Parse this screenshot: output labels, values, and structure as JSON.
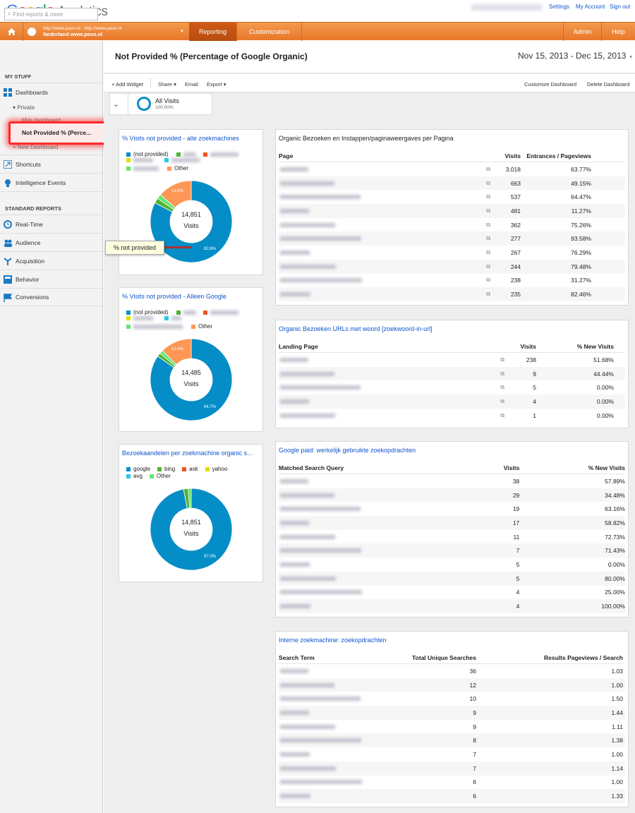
{
  "header": {
    "logo_google": "Google",
    "logo_app": "Analytics",
    "links": [
      "Settings",
      "My Account",
      "Sign out"
    ]
  },
  "nav": {
    "site_url": "http://www.pavo.nl - http://www.pavo.nl",
    "site_name": "Nederland www.pavo.nl",
    "tabs": [
      "Reporting",
      "Customization"
    ],
    "right": [
      "Admin",
      "Help"
    ]
  },
  "sidebar": {
    "search_placeholder": "Find reports & more",
    "my_stuff": "MY STUFF",
    "dashboards": "Dashboards",
    "private": "Private",
    "mijn": "Mijn dashboard",
    "not_provided": "Not Provided % (Perce...",
    "new_dashboard": "+ New Dashboard",
    "shortcuts": "Shortcuts",
    "intelligence": "Intelligence Events",
    "standard": "STANDARD REPORTS",
    "reports": [
      "Real-Time",
      "Audience",
      "Acquisition",
      "Behavior",
      "Conversions"
    ]
  },
  "page": {
    "title": "Not Provided % (Percentage of Google Organic)",
    "daterange": "Nov 15, 2013 - Dec 15, 2013"
  },
  "toolbar": {
    "add_widget": "+ Add Widget",
    "share": "Share",
    "email": "Email",
    "export": "Export",
    "customize": "Customize Dashboard",
    "delete": "Delete Dashboard"
  },
  "segment": {
    "name": "All Visits",
    "pct": "100.00%"
  },
  "tooltip": "% not provided",
  "donut1": {
    "title": "% Visits not provided - alle zoekmachines",
    "legend": [
      "(not provided)",
      "Other"
    ],
    "total": "14,851",
    "label": "Visits",
    "big": "82.6%",
    "small": "13.6%",
    "pct_main": 82.6,
    "pct_green": 2.0,
    "pct_green2": 1.8,
    "pct_orange": 13.6
  },
  "donut2": {
    "title": "% Visits not provided - Alleen Google",
    "legend": [
      "(not provided)",
      "Other"
    ],
    "total": "14,485",
    "label": "Visits",
    "big": "84.7%",
    "small": "12.4%",
    "pct_main": 84.7,
    "pct_green": 1.5,
    "pct_green2": 1.4,
    "pct_orange": 12.4
  },
  "donut3": {
    "title": "Bezoekaandelen per zoekmachine organic s...",
    "legend": [
      "google",
      "bing",
      "ask",
      "yahoo",
      "avg",
      "Other"
    ],
    "total": "14,851",
    "label": "Visits",
    "big": "97.0%",
    "pct_main": 97.0,
    "pct_green": 1.8,
    "pct_green2": 1.2
  },
  "colors": {
    "blue": "#058dc7",
    "green": "#50b432",
    "orange": "#ff9655",
    "red": "#ed561b",
    "yellow": "#dddf00",
    "lightblue": "#64e572",
    "gray": "#24cbe5",
    "accent": "#e9772a"
  },
  "t1": {
    "title": "Organic Bezoeken en Instappen/paginaweergaves per Pagina",
    "cols": [
      "Page",
      "Visits",
      "Entrances / Pageviews"
    ],
    "rows": [
      [
        "3,018",
        "63.77%"
      ],
      [
        "663",
        "49.15%"
      ],
      [
        "537",
        "64.47%"
      ],
      [
        "481",
        "11.27%"
      ],
      [
        "362",
        "75.26%"
      ],
      [
        "277",
        "93.58%"
      ],
      [
        "267",
        "76.29%"
      ],
      [
        "244",
        "79.48%"
      ],
      [
        "238",
        "31.27%"
      ],
      [
        "235",
        "82.46%"
      ]
    ]
  },
  "t2": {
    "title": "Organic Bezoeken URLs met woord [zoekwoord-in-url]",
    "cols": [
      "Landing Page",
      "Visits",
      "% New Visits"
    ],
    "rows": [
      [
        "238",
        "51.68%"
      ],
      [
        "9",
        "44.44%"
      ],
      [
        "5",
        "0.00%"
      ],
      [
        "4",
        "0.00%"
      ],
      [
        "1",
        "0.00%"
      ]
    ]
  },
  "t3": {
    "title": "Google paid: werkelijk gebruikte zoekopdrachten",
    "cols": [
      "Matched Search Query",
      "Visits",
      "% New Visits"
    ],
    "rows": [
      [
        "38",
        "57.89%"
      ],
      [
        "29",
        "34.48%"
      ],
      [
        "19",
        "63.16%"
      ],
      [
        "17",
        "58.82%"
      ],
      [
        "11",
        "72.73%"
      ],
      [
        "7",
        "71.43%"
      ],
      [
        "5",
        "0.00%"
      ],
      [
        "5",
        "80.00%"
      ],
      [
        "4",
        "25.00%"
      ],
      [
        "4",
        "100.00%"
      ]
    ]
  },
  "t4": {
    "title": "Interne zoekmachine: zoekopdrachten",
    "cols": [
      "Search Term",
      "Total Unique Searches",
      "Results Pageviews / Search"
    ],
    "rows": [
      [
        "36",
        "1.03"
      ],
      [
        "12",
        "1.00"
      ],
      [
        "10",
        "1.50"
      ],
      [
        "9",
        "1.44"
      ],
      [
        "9",
        "1.11"
      ],
      [
        "8",
        "1.38"
      ],
      [
        "7",
        "1.00"
      ],
      [
        "7",
        "1.14"
      ],
      [
        "6",
        "1.00"
      ],
      [
        "6",
        "1.33"
      ]
    ]
  }
}
